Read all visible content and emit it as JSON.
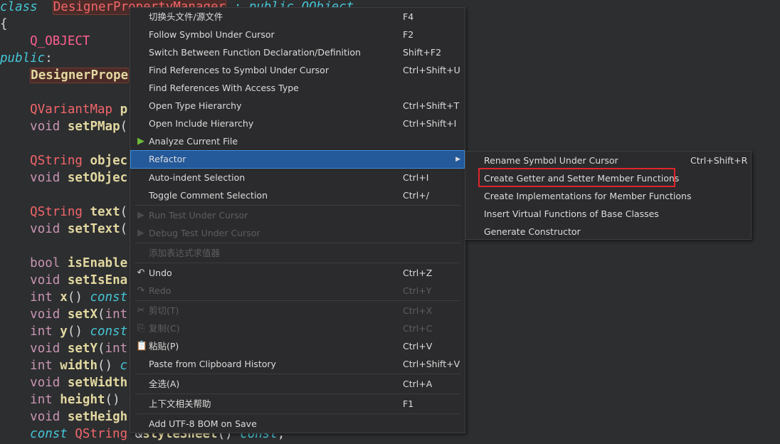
{
  "code": {
    "lines": [
      [
        [
          "kw",
          "class"
        ],
        [
          "",
          "  "
        ],
        [
          "ty hl",
          "DesignerPropertyManager"
        ],
        [
          "",
          "",
          " "
        ],
        [
          "kw",
          " : public QObject"
        ]
      ],
      [
        [
          "",
          "{"
        ]
      ],
      [
        [
          "",
          "    "
        ],
        [
          "mac",
          "Q_OBJECT"
        ]
      ],
      [
        [
          "kw",
          "public"
        ],
        [
          "",
          ":"
        ]
      ],
      [
        [
          "",
          "    "
        ],
        [
          "fn hl",
          "DesignerPrope"
        ]
      ],
      [],
      [
        [
          "",
          "    "
        ],
        [
          "ty",
          "QVariantMap"
        ],
        [
          "fn",
          " p"
        ]
      ],
      [
        [
          "",
          "    "
        ],
        [
          "pt",
          "void"
        ],
        [
          "fn",
          " setPMap"
        ],
        [
          "",
          "("
        ]
      ],
      [],
      [
        [
          "",
          "    "
        ],
        [
          "ty",
          "QString"
        ],
        [
          "fn",
          " objec"
        ]
      ],
      [
        [
          "",
          "    "
        ],
        [
          "pt",
          "void"
        ],
        [
          "fn",
          " setObjec"
        ]
      ],
      [],
      [
        [
          "",
          "    "
        ],
        [
          "ty",
          "QString"
        ],
        [
          "fn",
          " text"
        ],
        [
          "",
          "("
        ]
      ],
      [
        [
          "",
          "    "
        ],
        [
          "pt",
          "void"
        ],
        [
          "fn",
          " setText"
        ],
        [
          "",
          "("
        ]
      ],
      [],
      [
        [
          "",
          "    "
        ],
        [
          "pt",
          "bool"
        ],
        [
          "fn",
          " isEnable"
        ]
      ],
      [
        [
          "",
          "    "
        ],
        [
          "pt",
          "void"
        ],
        [
          "fn",
          " setIsEna"
        ]
      ],
      [
        [
          "",
          "    "
        ],
        [
          "pt",
          "int"
        ],
        [
          "fn",
          " x"
        ],
        [
          "",
          "() "
        ],
        [
          "kw",
          "const"
        ]
      ],
      [
        [
          "",
          "    "
        ],
        [
          "pt",
          "void"
        ],
        [
          "fn",
          " setX"
        ],
        [
          "",
          "("
        ],
        [
          "pt",
          "int"
        ]
      ],
      [
        [
          "",
          "    "
        ],
        [
          "pt",
          "int"
        ],
        [
          "fn",
          " y"
        ],
        [
          "",
          "() "
        ],
        [
          "kw",
          "const"
        ]
      ],
      [
        [
          "",
          "    "
        ],
        [
          "pt",
          "void"
        ],
        [
          "fn",
          " setY"
        ],
        [
          "",
          "("
        ],
        [
          "pt",
          "int"
        ]
      ],
      [
        [
          "",
          "    "
        ],
        [
          "pt",
          "int"
        ],
        [
          "fn",
          " width"
        ],
        [
          "",
          "() "
        ],
        [
          "kw",
          "c"
        ]
      ],
      [
        [
          "",
          "    "
        ],
        [
          "pt",
          "void"
        ],
        [
          "fn",
          " setWidth"
        ]
      ],
      [
        [
          "",
          "    "
        ],
        [
          "pt",
          "int"
        ],
        [
          "fn",
          " height"
        ],
        [
          "",
          "()"
        ]
      ],
      [
        [
          "",
          "    "
        ],
        [
          "pt",
          "void"
        ],
        [
          "fn",
          " setHeigh"
        ]
      ],
      [
        [
          "",
          "    "
        ],
        [
          "kw",
          "const"
        ],
        [
          "ty",
          " QString"
        ],
        [
          "",
          " &"
        ],
        [
          "fn",
          "styleSheet"
        ],
        [
          "",
          "() "
        ],
        [
          "kw",
          "const"
        ],
        [
          "",
          ";"
        ]
      ]
    ]
  },
  "menu": {
    "items": [
      {
        "label": "切换头文件/源文件",
        "shortcut": "F4"
      },
      {
        "label": "Follow Symbol Under Cursor",
        "shortcut": "F2"
      },
      {
        "label": "Switch Between Function Declaration/Definition",
        "shortcut": "Shift+F2"
      },
      {
        "label": "Find References to Symbol Under Cursor",
        "shortcut": "Ctrl+Shift+U"
      },
      {
        "label": "Find References With Access Type",
        "shortcut": ""
      },
      {
        "label": "Open Type Hierarchy",
        "shortcut": "Ctrl+Shift+T"
      },
      {
        "label": "Open Include Hierarchy",
        "shortcut": "Ctrl+Shift+I"
      },
      {
        "label": "Analyze Current File",
        "shortcut": "",
        "icon": "analyze-icon"
      },
      {
        "label": "Refactor",
        "shortcut": "",
        "selected": true,
        "submenu": true
      },
      {
        "label": "Auto-indent Selection",
        "shortcut": "Ctrl+I"
      },
      {
        "label": "Toggle Comment Selection",
        "shortcut": "Ctrl+/",
        "sepAfter": true
      },
      {
        "label": "Run Test Under Cursor",
        "shortcut": "",
        "disabled": true,
        "icon": "run-icon"
      },
      {
        "label": "Debug Test Under Cursor",
        "shortcut": "",
        "disabled": true,
        "icon": "debug-icon",
        "sepAfter": true
      },
      {
        "label": "添加表达式求值器",
        "shortcut": "",
        "disabled": true,
        "sepAfter": true
      },
      {
        "label": "Undo",
        "shortcut": "Ctrl+Z",
        "icon": "undo-icon"
      },
      {
        "label": "Redo",
        "shortcut": "Ctrl+Y",
        "disabled": true,
        "icon": "redo-icon",
        "sepAfter": true
      },
      {
        "label": "剪切(T)",
        "shortcut": "Ctrl+X",
        "disabled": true,
        "icon": "cut-icon"
      },
      {
        "label": "复制(C)",
        "shortcut": "Ctrl+C",
        "disabled": true,
        "icon": "copy-icon"
      },
      {
        "label": "粘贴(P)",
        "shortcut": "Ctrl+V",
        "icon": "paste-icon"
      },
      {
        "label": "Paste from Clipboard History",
        "shortcut": "Ctrl+Shift+V",
        "sepAfter": true
      },
      {
        "label": "全选(A)",
        "shortcut": "Ctrl+A",
        "sepAfter": true
      },
      {
        "label": "上下文相关帮助",
        "shortcut": "F1",
        "sepAfter": true
      },
      {
        "label": "Add UTF-8 BOM on Save",
        "shortcut": ""
      }
    ]
  },
  "submenu": {
    "items": [
      {
        "label": "Rename Symbol Under Cursor",
        "shortcut": "Ctrl+Shift+R"
      },
      {
        "label": "Create Getter and Setter Member Functions",
        "shortcut": "",
        "highlighted": true
      },
      {
        "label": "Create Implementations for Member Functions",
        "shortcut": ""
      },
      {
        "label": "Insert Virtual Functions of Base Classes",
        "shortcut": ""
      },
      {
        "label": "Generate Constructor",
        "shortcut": ""
      }
    ]
  },
  "colors": {
    "highlight": "#24599a",
    "annotation": "#e0242a",
    "analyze_icon": "#6dbb3a"
  }
}
